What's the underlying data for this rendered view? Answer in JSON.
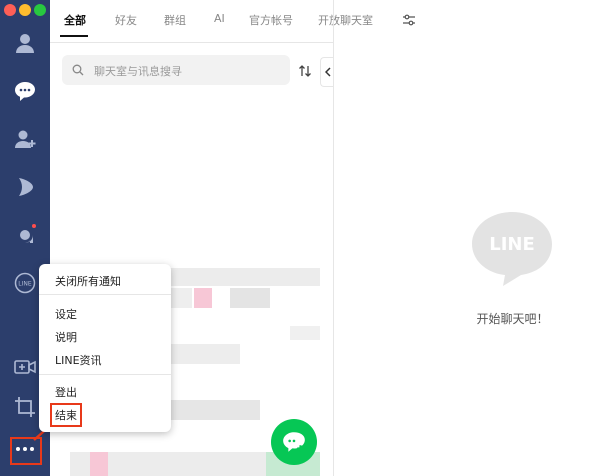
{
  "tabs": [
    "全部",
    "好友",
    "群组",
    "AI",
    "官方帐号",
    "开放聊天室"
  ],
  "search": {
    "placeholder": "聊天室与讯息搜寻"
  },
  "empty_state": {
    "logo_text": "LINE",
    "message": "开始聊天吧！"
  },
  "sidebar": {
    "icons": [
      "profile-icon",
      "chats-icon",
      "add-friend-icon",
      "voom-icon",
      "line-app-icon",
      "line-circle-icon",
      "video-call-icon",
      "crop-icon",
      "more-icon"
    ]
  },
  "context_menu": {
    "mute_all": "关闭所有通知",
    "settings": "设定",
    "help": "说明",
    "line_info": "LINE资讯",
    "logout": "登出",
    "quit": "结束"
  },
  "colors": {
    "sidebar": "#2c3e6c",
    "line_green": "#06c755",
    "annotation": "#e8391a"
  }
}
